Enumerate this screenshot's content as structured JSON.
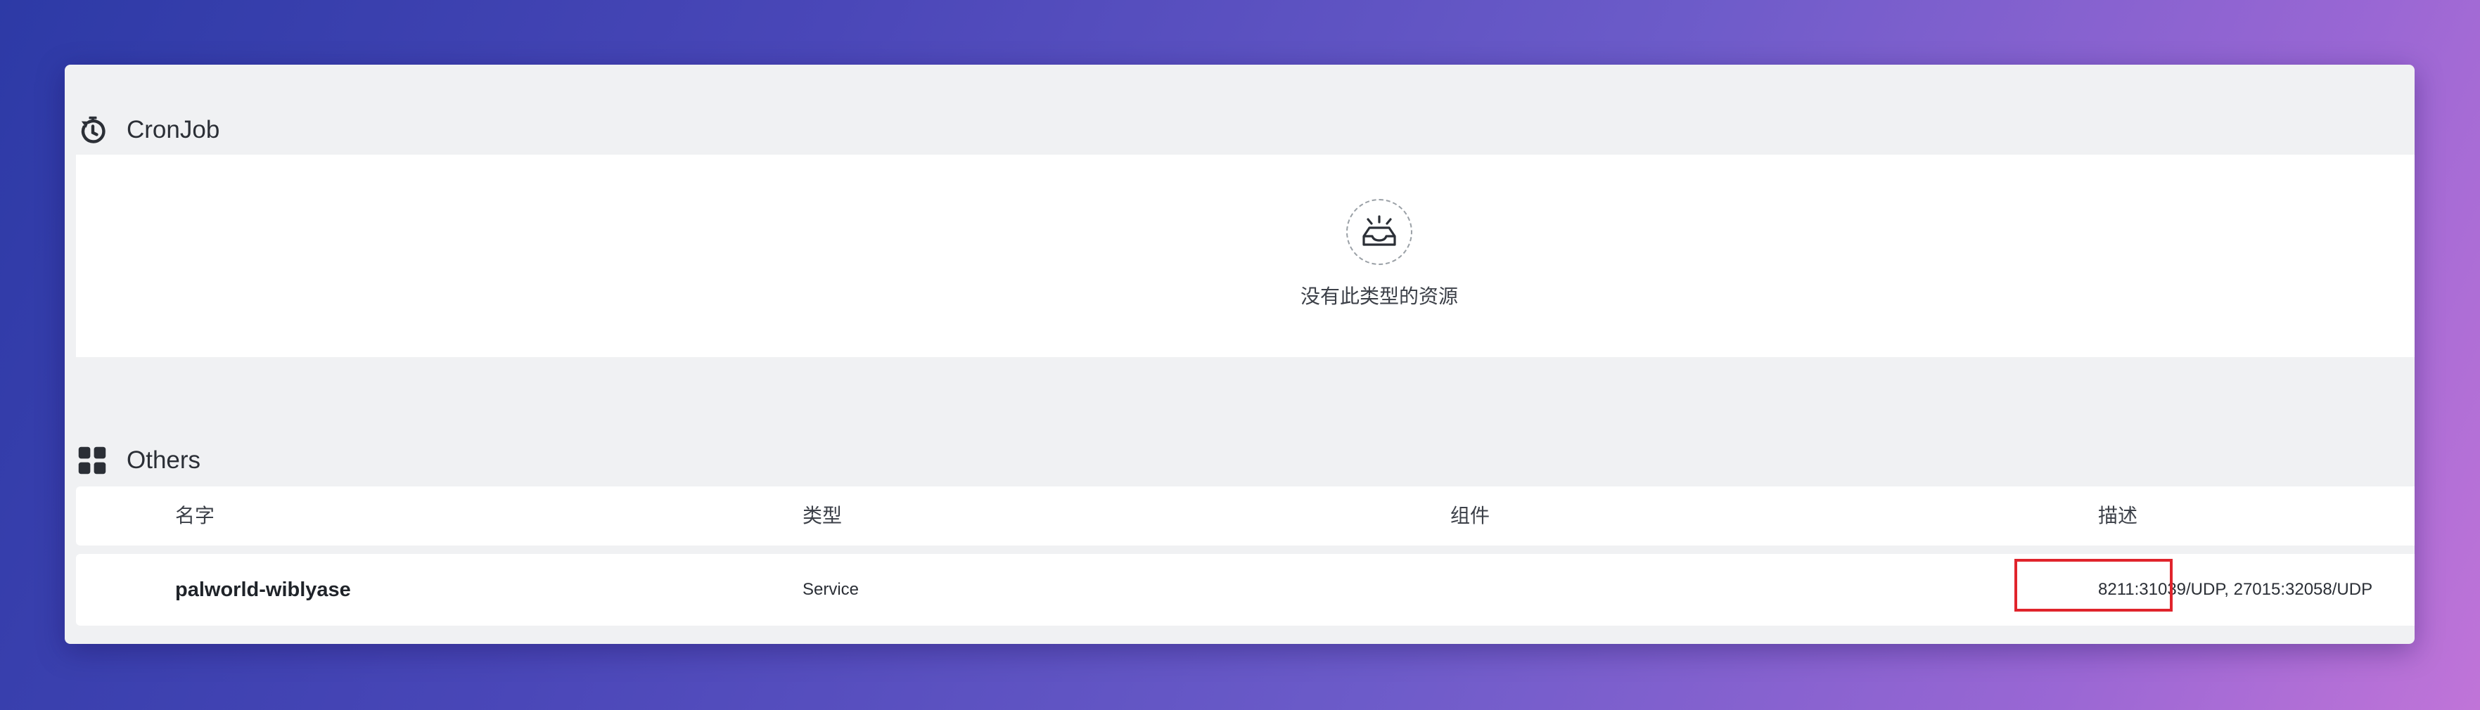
{
  "cronjob_section": {
    "title": "CronJob",
    "icon": "timer-reset-icon",
    "empty_message": "没有此类型的资源"
  },
  "others_section": {
    "title": "Others",
    "icon": "grid-apps-icon",
    "columns": {
      "name": "名字",
      "type": "类型",
      "component": "组件",
      "description": "描述"
    },
    "rows": [
      {
        "name": "palworld-wiblyase",
        "type": "Service",
        "component": "",
        "description": "8211:31039/UDP, 27015:32058/UDP"
      }
    ]
  },
  "annotation": {
    "highlight_color": "#e0242c"
  }
}
